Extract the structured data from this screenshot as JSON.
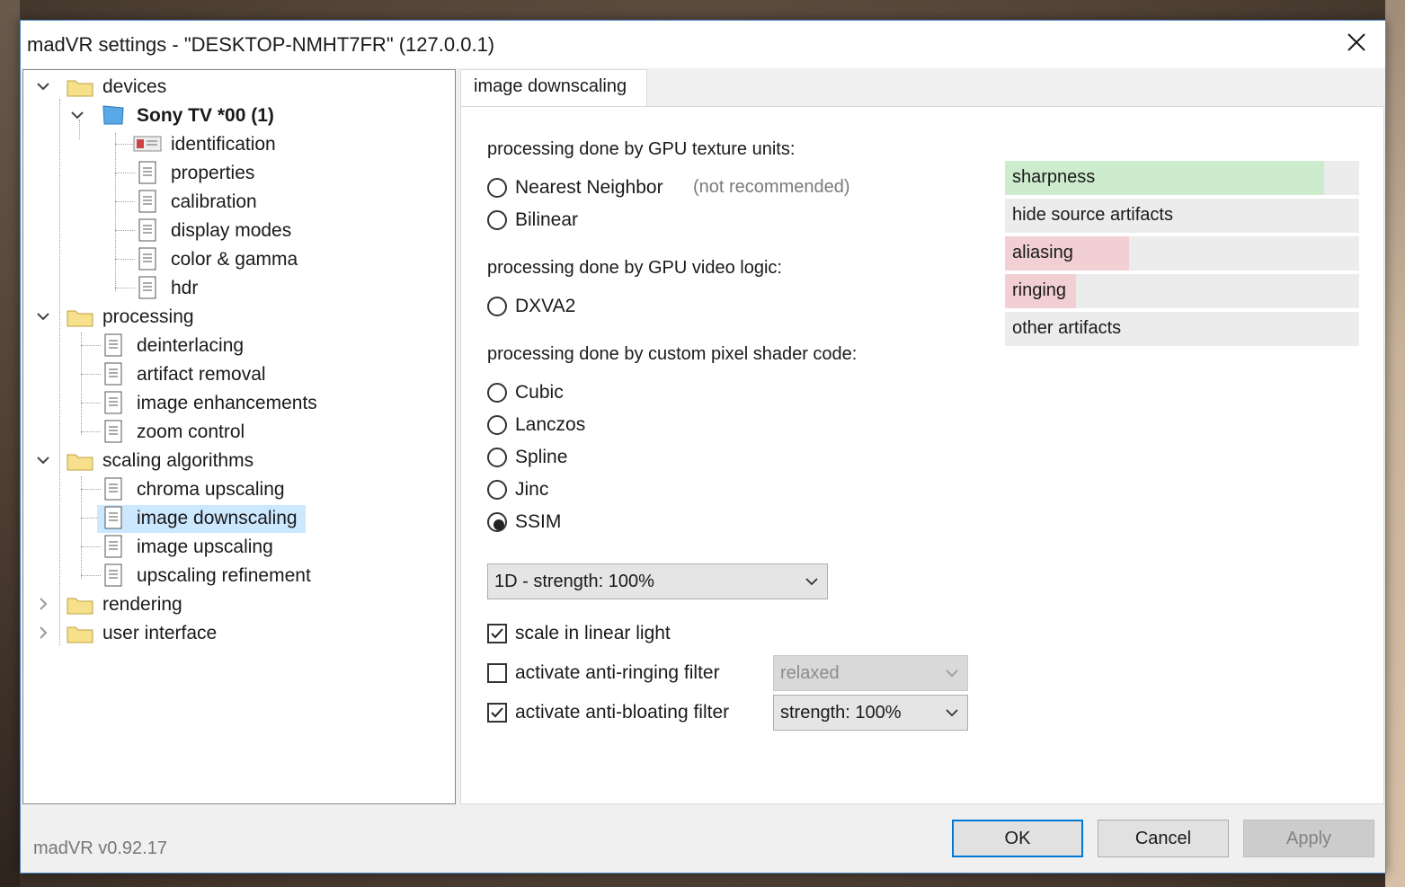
{
  "window": {
    "title": "madVR settings - \"DESKTOP-NMHT7FR\" (127.0.0.1)",
    "version": "madVR v0.92.17"
  },
  "tree": {
    "devices": "devices",
    "device": "Sony TV *00 (1)",
    "device_items": [
      "identification",
      "properties",
      "calibration",
      "display modes",
      "color & gamma",
      "hdr"
    ],
    "processing": "processing",
    "processing_items": [
      "deinterlacing",
      "artifact removal",
      "image enhancements",
      "zoom control"
    ],
    "scaling": "scaling algorithms",
    "scaling_items": [
      "chroma upscaling",
      "image downscaling",
      "image upscaling",
      "upscaling refinement"
    ],
    "selected": "image downscaling",
    "rendering": "rendering",
    "user_interface": "user interface"
  },
  "tab": {
    "label": "image downscaling"
  },
  "settings": {
    "gpu_texture_label": "processing done by GPU texture units:",
    "nearest": "Nearest Neighbor",
    "nearest_hint": "(not recommended)",
    "bilinear": "Bilinear",
    "gpu_video_label": "processing done by GPU video logic:",
    "dxva2": "DXVA2",
    "shader_label": "processing done by custom pixel shader code:",
    "cubic": "Cubic",
    "lanczos": "Lanczos",
    "spline": "Spline",
    "jinc": "Jinc",
    "ssim": "SSIM",
    "selected_algorithm": "SSIM",
    "strength_select": "1D - strength: 100%",
    "linear_light": {
      "label": "scale in linear light",
      "checked": true
    },
    "anti_ringing": {
      "label": "activate anti-ringing filter",
      "checked": false,
      "select": "relaxed",
      "enabled": false
    },
    "anti_bloating": {
      "label": "activate anti-bloating filter",
      "checked": true,
      "select": "strength: 100%",
      "enabled": true
    }
  },
  "quality_bars": [
    {
      "label": "sharpness",
      "level": 0.9,
      "color": "#cdeccd"
    },
    {
      "label": "hide source artifacts",
      "level": 0.0,
      "color": "#cdeccd"
    },
    {
      "label": "aliasing",
      "level": 0.35,
      "color": "#f1cfd2"
    },
    {
      "label": "ringing",
      "level": 0.2,
      "color": "#f1cfd2"
    },
    {
      "label": "other artifacts",
      "level": 0.0,
      "color": "#f1cfd2"
    }
  ],
  "buttons": {
    "ok": "OK",
    "cancel": "Cancel",
    "apply": "Apply"
  },
  "icons": {
    "close": "close-icon",
    "folder": "folder-icon",
    "page": "page-icon",
    "monitor": "monitor-icon",
    "id": "id-card-icon"
  }
}
